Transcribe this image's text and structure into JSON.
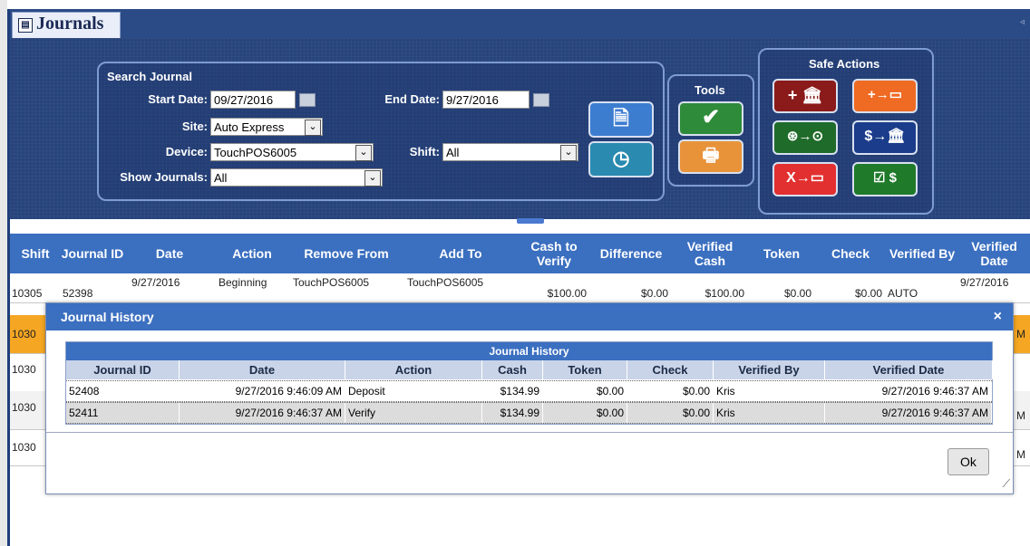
{
  "window": {
    "tab_title": "Journals",
    "tab_icon": "journal-icon",
    "pin_glyph": "◃"
  },
  "search": {
    "title": "Search Journal",
    "start_date_label": "Start Date:",
    "start_date_value": "09/27/2016",
    "end_date_label": "End Date:",
    "end_date_value": "9/27/2016",
    "site_label": "Site:",
    "site_value": "Auto Express",
    "device_label": "Device:",
    "device_value": "TouchPOS6005",
    "shift_label": "Shift:",
    "shift_value": "All",
    "show_journals_label": "Show Journals:",
    "show_journals_value": "All"
  },
  "tools": {
    "title": "Tools"
  },
  "safe_actions": {
    "title": "Safe Actions"
  },
  "grid": {
    "columns": [
      "Shift",
      "Journal ID",
      "Date",
      "Action",
      "Remove From",
      "Add To",
      "Cash to Verify",
      "Difference",
      "Verified Cash",
      "Token",
      "Check",
      "Verified By",
      "Verified Date"
    ],
    "rows": [
      {
        "shift": "10305",
        "journal_id": "52398",
        "date": "9/27/2016",
        "action": "Beginning",
        "remove_from": "TouchPOS6005",
        "add_to": "TouchPOS6005",
        "cash_to_verify": "$100.00",
        "difference": "$0.00",
        "verified_cash": "$100.00",
        "token": "$0.00",
        "check": "$0.00",
        "verified_by": "AUTO",
        "verified_date": "9/27/2016"
      },
      {
        "shift": "1030",
        "verified_date": "M"
      },
      {
        "shift": "1030",
        "verified_date": ""
      },
      {
        "shift": "1030",
        "verified_date": "M"
      },
      {
        "shift": "1030",
        "verified_date": "M"
      }
    ]
  },
  "dialog": {
    "title": "Journal History",
    "close_glyph": "×",
    "table_title": "Journal History",
    "columns": [
      "Journal ID",
      "Date",
      "Action",
      "Cash",
      "Token",
      "Check",
      "Verified By",
      "Verified Date"
    ],
    "rows": [
      {
        "journal_id": "52408",
        "date": "9/27/2016 9:46:09 AM",
        "action": "Deposit",
        "cash": "$134.99",
        "token": "$0.00",
        "check": "$0.00",
        "verified_by": "Kris",
        "verified_date": "9/27/2016 9:46:37 AM"
      },
      {
        "journal_id": "52411",
        "date": "9/27/2016 9:46:37 AM",
        "action": "Verify",
        "cash": "$134.99",
        "token": "$0.00",
        "check": "$0.00",
        "verified_by": "Kris",
        "verified_date": "9/27/2016 9:46:37 AM"
      }
    ],
    "ok_label": "Ok"
  },
  "colors": {
    "toolbar_bg": "#27437b",
    "header_blue": "#3b6fc0",
    "selected_row": "#f5a623"
  }
}
